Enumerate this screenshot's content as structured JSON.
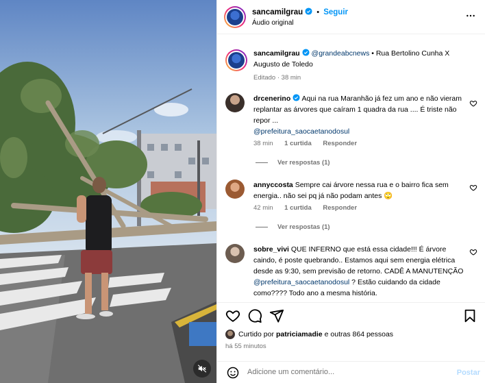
{
  "header": {
    "username": "sancamilgrau",
    "follow_label": "Seguir",
    "audio": "Áudio original"
  },
  "caption": {
    "username": "sancamilgrau",
    "mention": "@grandeabcnews",
    "text": " • Rua Bertolino Cunha X Augusto de Toledo",
    "meta": "Editado · 38 min"
  },
  "comments": [
    {
      "username": "drcenerino",
      "text": " Aqui na rua Maranhão já fez um ano e não vieram replantar as árvores que caíram 1 quadra da rua .... É triste não repor ...",
      "mention": "@prefeitura_saocaetanodosul",
      "time": "38 min",
      "likes": "1 curtida",
      "reply": "Responder",
      "view_replies": "Ver respostas (1)"
    },
    {
      "username": "annyccosta",
      "text": " Sempre cai árvore nessa rua e o bairro fica sem energia.. não sei pq já não podam antes 🙄",
      "time": "42 min",
      "likes": "1 curtida",
      "reply": "Responder",
      "view_replies": "Ver respostas (1)"
    },
    {
      "username": "sobre_vivi",
      "text": " QUE INFERNO que está essa cidade!!! É árvore caindo, é poste quebrando.. Estamos aqui sem energia elétrica desde as 9:30, sem previsão de retorno. CADÊ A MANUTENÇÃO ",
      "mention": "@prefeitura_saocaetanodosul",
      "text_after": " ? Estão cuidando da cidade como???? Todo ano a mesma história."
    }
  ],
  "likes": {
    "prefix": "Curtido por",
    "user": "patriciamadie",
    "suffix": "e outras 864 pessoas"
  },
  "post_time": "há 55 minutos",
  "comment_box": {
    "placeholder": "Adicione um comentário...",
    "post_label": "Postar"
  },
  "colors": {
    "accent": "#0095f6",
    "mention": "#00376b",
    "secondary_text": "#737373"
  }
}
